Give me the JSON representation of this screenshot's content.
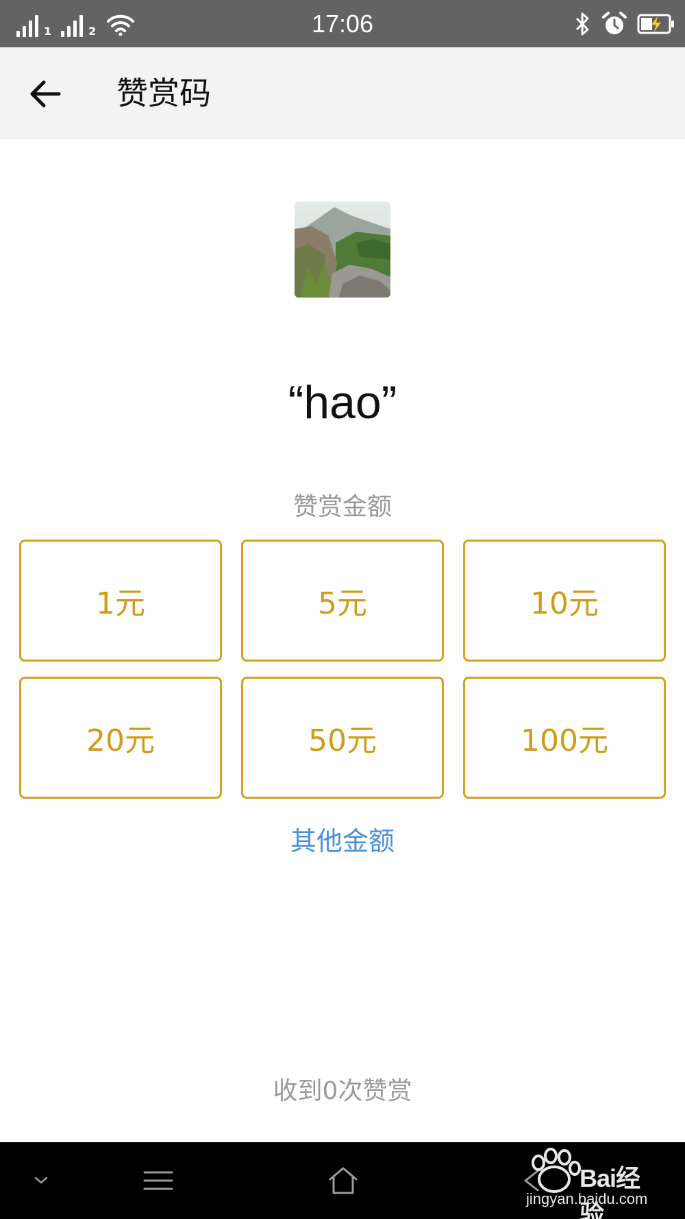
{
  "status_bar": {
    "time": "17:06",
    "sim1": "1",
    "sim2": "2",
    "icons": [
      "signal-icon",
      "wifi-icon",
      "bluetooth-icon",
      "alarm-icon",
      "battery-charging-icon"
    ]
  },
  "header": {
    "back_icon": "arrow-left-icon",
    "title": "赞赏码"
  },
  "profile": {
    "avatar": "landscape-photo",
    "quote": "“hao”"
  },
  "reward": {
    "label": "赞赏金额",
    "amounts": [
      "1元",
      "5元",
      "10元",
      "20元",
      "50元",
      "100元"
    ],
    "other_amount": "其他金额",
    "received_count": "收到0次赞赏"
  },
  "nav_bar": {
    "icons": [
      "chevron-down-icon",
      "menu-icon",
      "home-icon",
      "back-icon"
    ]
  },
  "watermark": {
    "brand": "Bai经验",
    "url": "jingyan.baidu.com"
  },
  "colors": {
    "accent": "#d4a21b",
    "link": "#4a90d9",
    "status_bar_bg": "#636363",
    "header_bg": "#f3f3f3",
    "nav_bg": "#000000"
  }
}
